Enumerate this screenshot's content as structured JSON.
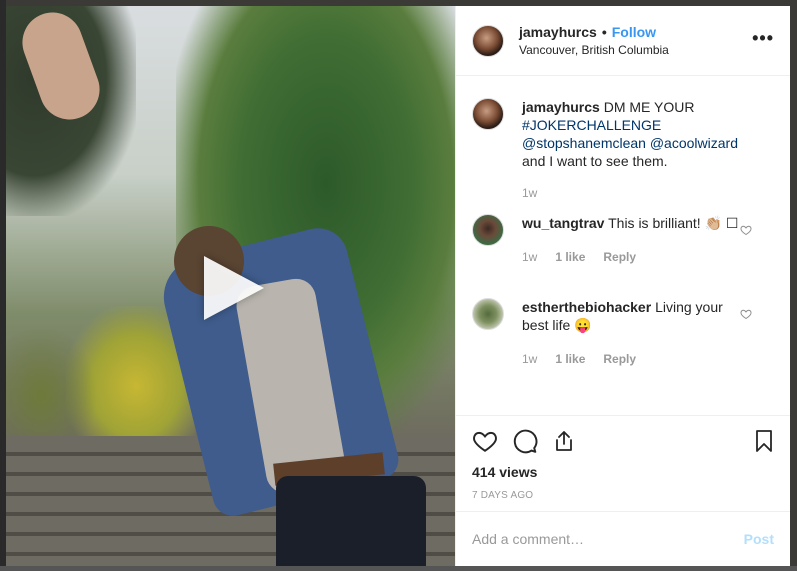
{
  "post": {
    "author": "jamayhurcs",
    "separator": "•",
    "follow_label": "Follow",
    "location": "Vancouver, British Columbia",
    "more_label": "•••"
  },
  "caption": {
    "username": "jamayhurcs",
    "text_before": "DM ME YOUR",
    "hashtag": "#JOKERCHALLENGE",
    "mention1": "@stopshanemclean",
    "mention2": "@acoolwizard",
    "text_after": "and I want to see them.",
    "time": "1w"
  },
  "comments": [
    {
      "username": "wu_tangtrav",
      "text": "This is brilliant! 👏🏼",
      "trailing": "☐",
      "time": "1w",
      "likes": "1 like",
      "reply": "Reply"
    },
    {
      "username": "estherthebiohacker",
      "text": "Living your best life 😛",
      "time": "1w",
      "likes": "1 like",
      "reply": "Reply"
    }
  ],
  "stats": {
    "views": "414 views",
    "date": "7 DAYS AGO"
  },
  "composer": {
    "placeholder": "Add a comment…",
    "post_label": "Post"
  },
  "icons": [
    "play-icon",
    "more-icon",
    "heart-icon",
    "comment-icon",
    "share-icon",
    "bookmark-icon"
  ]
}
